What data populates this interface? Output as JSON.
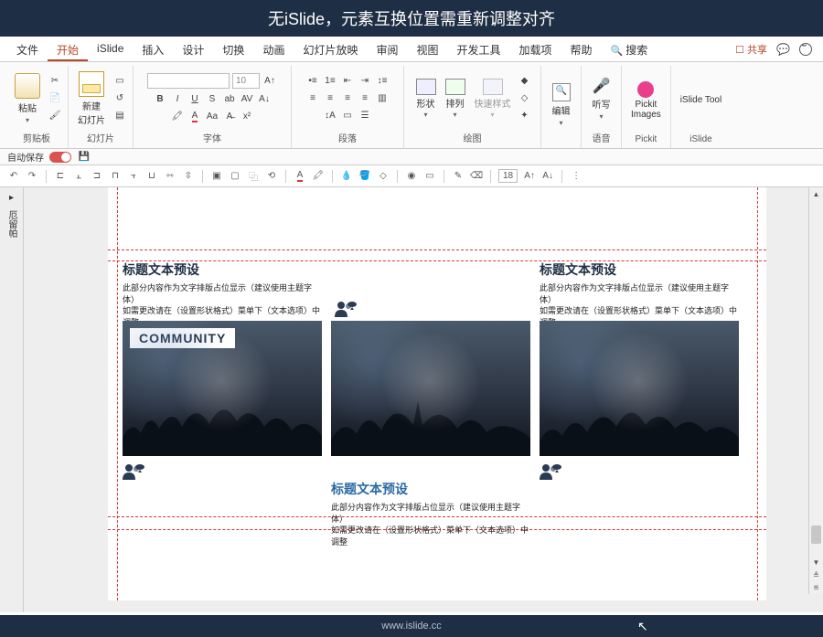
{
  "banner": {
    "text": "无iSlide，元素互换位置需重新调整对齐"
  },
  "tabs": {
    "items": [
      "文件",
      "开始",
      "iSlide",
      "插入",
      "设计",
      "切换",
      "动画",
      "幻灯片放映",
      "审阅",
      "视图",
      "开发工具",
      "加载项",
      "帮助"
    ],
    "active_index": 1,
    "search": "搜索",
    "share": "☐ 共享"
  },
  "ribbon": {
    "clipboard": {
      "paste": "粘贴",
      "label": "剪贴板"
    },
    "slides": {
      "newslide": "新建\n幻灯片",
      "label": "幻灯片"
    },
    "font": {
      "label": "字体",
      "font_name": "",
      "font_size": "10"
    },
    "para": {
      "label": "段落"
    },
    "draw": {
      "shapes": "形状",
      "arrange": "排列",
      "quick": "快速样式",
      "label": "绘图"
    },
    "edit": {
      "btn": "编辑",
      "label": ""
    },
    "voice": {
      "btn": "听写",
      "label": "语音"
    },
    "pickit": {
      "btn": "Pickit\nImages",
      "label": "Pickit"
    },
    "islide": {
      "btn": "iSlide Tool",
      "label": "iSlide"
    }
  },
  "autosave": {
    "label": "自动保存"
  },
  "qat": {
    "fontsize": "18"
  },
  "left_rail": {
    "arrow": "▸",
    "label": "厄留帕"
  },
  "slide": {
    "card1": {
      "title": "标题文本预设",
      "line1": "此部分内容作为文字排版占位显示（建议使用主题字体）",
      "line2": "如需更改请在（设置形状格式）菜单下（文本选项）中调整",
      "community": "COMMUNITY"
    },
    "card2": {
      "title": "标题文本预设",
      "line1": "此部分内容作为文字排版占位显示（建议使用主题字体）",
      "line2": "如需更改请在（设置形状格式）菜单下（文本选项）中调整"
    },
    "card3": {
      "title": "标题文本预设",
      "line1": "此部分内容作为文字排版占位显示（建议使用主题字体）",
      "line2": "如需更改请在（设置形状格式）菜单下（文本选项）中调整"
    }
  },
  "footer": {
    "url": "www.islide.cc"
  }
}
